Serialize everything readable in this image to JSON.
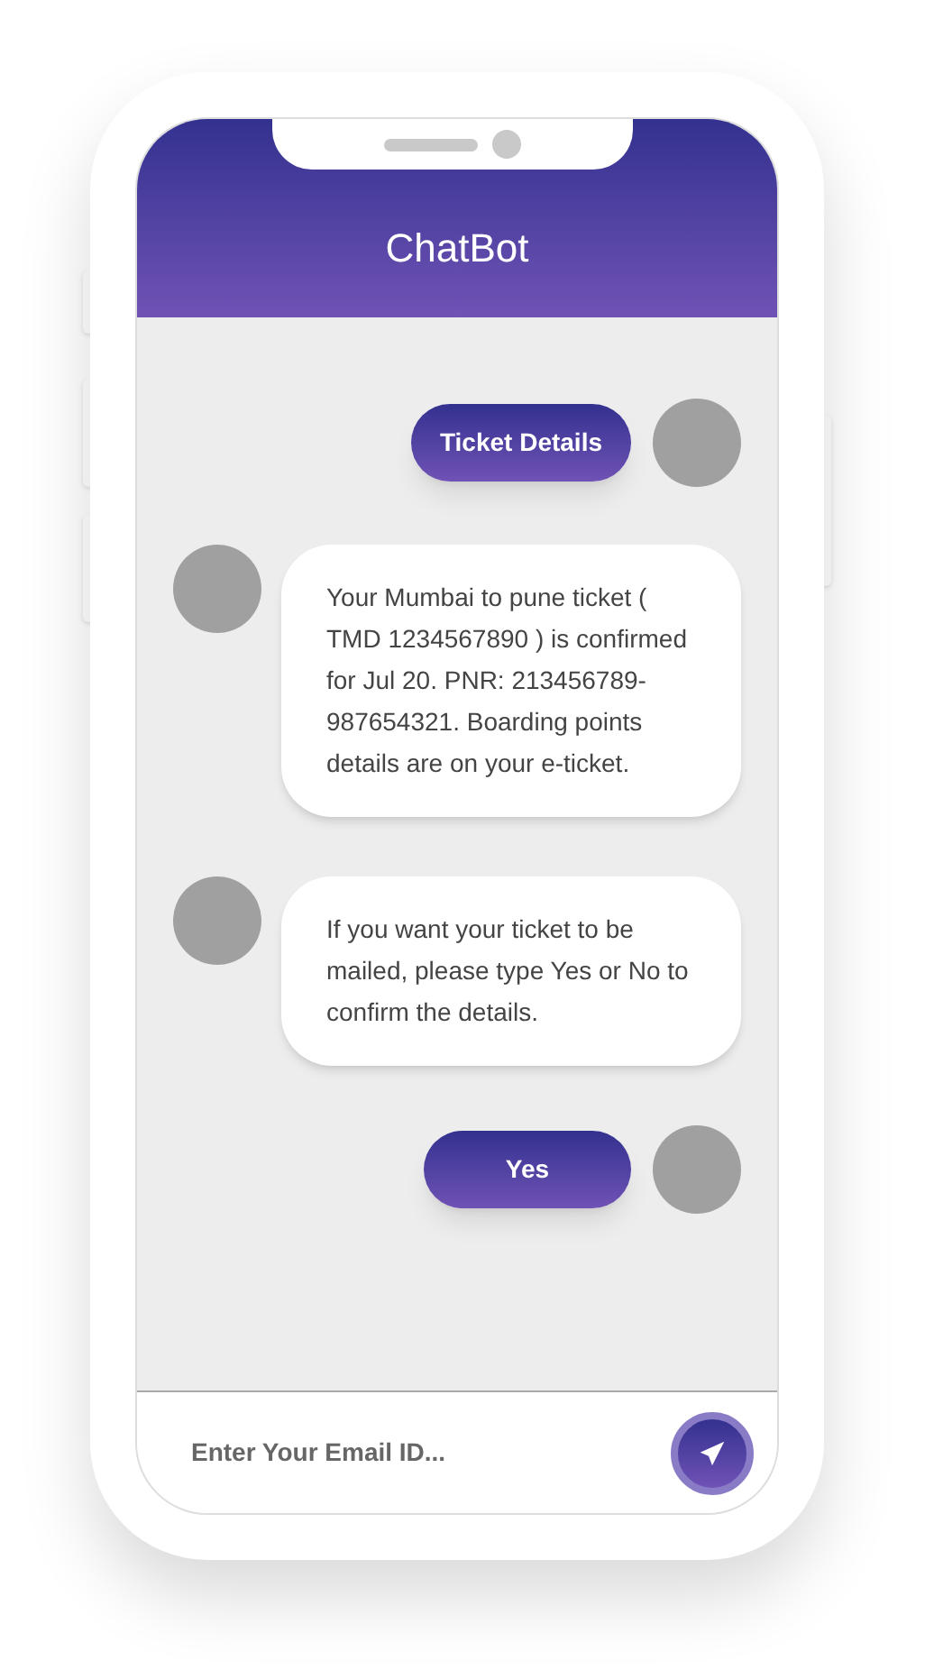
{
  "header": {
    "title": "ChatBot"
  },
  "messages": [
    {
      "kind": "user",
      "text": "Ticket Details"
    },
    {
      "kind": "bot",
      "text": "Your Mumbai to pune ticket ( TMD 1234567890 ) is confirmed for Jul 20. PNR: 213456789-987654321. Boarding points details are on your e-ticket."
    },
    {
      "kind": "bot",
      "text": "If you want your ticket to be mailed, please type Yes or No to confirm the details."
    },
    {
      "kind": "user",
      "text": "Yes"
    }
  ],
  "composer": {
    "placeholder": "Enter Your Email ID..."
  }
}
